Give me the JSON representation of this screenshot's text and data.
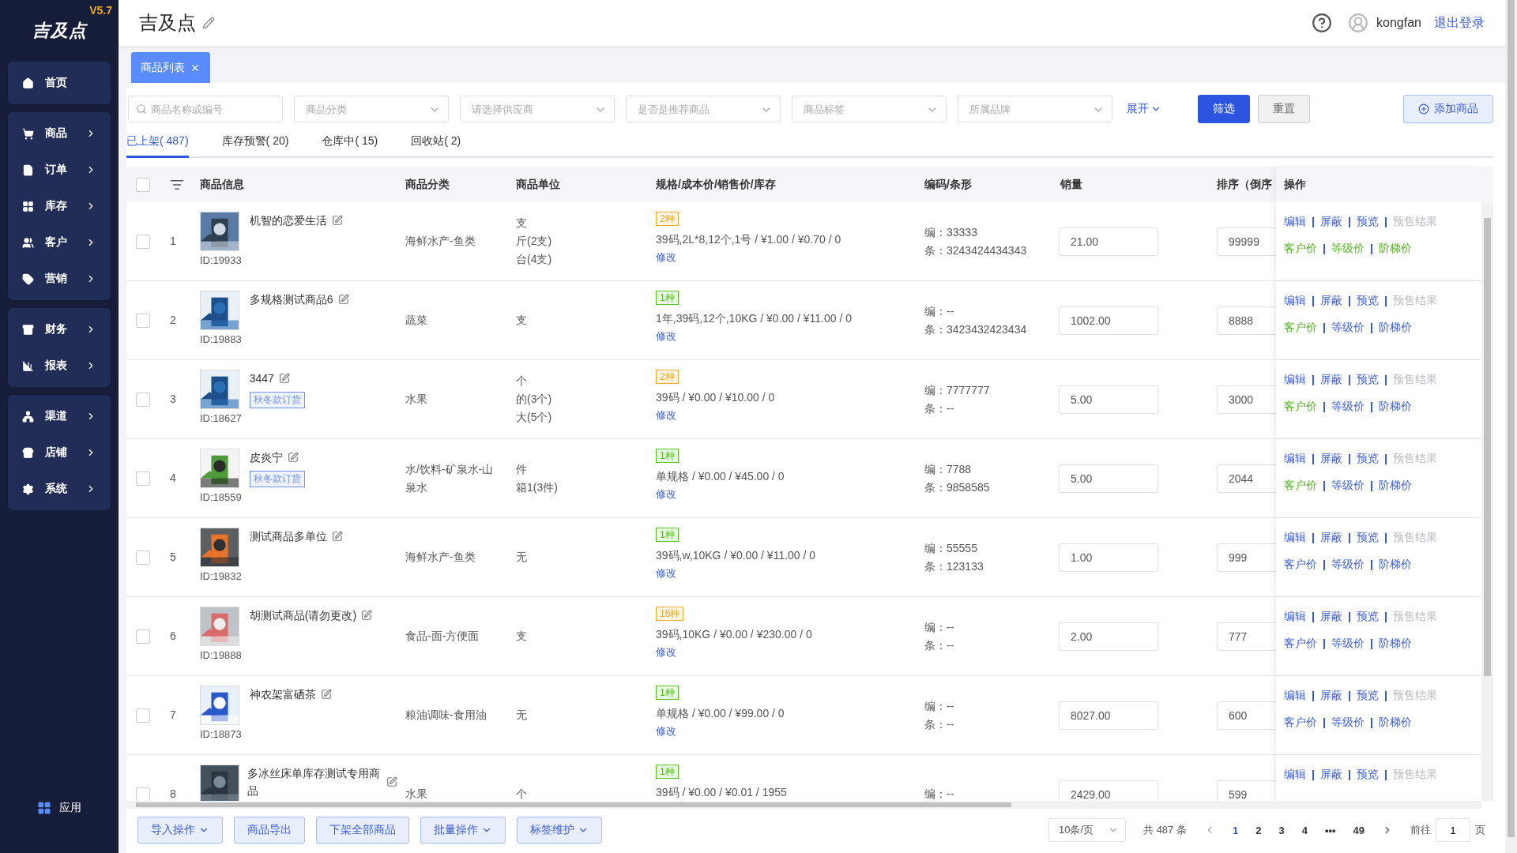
{
  "sidebar": {
    "logo": "吉及点",
    "version": "V5.7",
    "groups": [
      {
        "items": [
          {
            "label": "首页",
            "has_arrow": false
          }
        ]
      },
      {
        "items": [
          {
            "label": "商品",
            "has_arrow": true
          },
          {
            "label": "订单",
            "has_arrow": true
          },
          {
            "label": "库存",
            "has_arrow": true
          },
          {
            "label": "客户",
            "has_arrow": true
          },
          {
            "label": "营销",
            "has_arrow": true
          }
        ]
      },
      {
        "items": [
          {
            "label": "财务",
            "has_arrow": true
          },
          {
            "label": "报表",
            "has_arrow": true
          }
        ]
      },
      {
        "items": [
          {
            "label": "渠道",
            "has_arrow": true
          },
          {
            "label": "店铺",
            "has_arrow": true
          },
          {
            "label": "系统",
            "has_arrow": true
          }
        ]
      }
    ],
    "apps": "应用"
  },
  "header": {
    "title": "吉及点",
    "user": "kongfan",
    "logout": "退出登录"
  },
  "page_tabs": [
    {
      "label": "商品列表",
      "selected": true
    }
  ],
  "filters": {
    "search": {
      "placeholder": "商品名称或编号"
    },
    "selects": [
      {
        "placeholder": "商品分类"
      },
      {
        "placeholder": "请选择供应商"
      },
      {
        "placeholder": "是否是推荐商品"
      },
      {
        "placeholder": "商品标签"
      },
      {
        "placeholder": "所属品牌"
      }
    ],
    "expand": "展开",
    "filter_button": "筛选",
    "reset_button": "重置",
    "add_button": "添加商品"
  },
  "status_tabs": [
    {
      "label": "已上架( 487)",
      "selected": true
    },
    {
      "label": "库存预警( 20)",
      "selected": false
    },
    {
      "label": "仓库中( 15)",
      "selected": false
    },
    {
      "label": "回收站( 2)",
      "selected": false
    }
  ],
  "table": {
    "select_all_checked": false,
    "columns": [
      "商品信息",
      "商品分类",
      "商品单位",
      "规格/成本价/销售价/库存",
      "编码/条形",
      "销量",
      "排序（倒序",
      "操作"
    ],
    "rows": [
      {
        "index": "1",
        "checked": false,
        "name": "机智的恋爱生活",
        "id": "ID:19933",
        "category": "海鲜水产-鱼类",
        "units": [
          "支",
          "斤(2支)",
          "台(4支)"
        ],
        "spec": {
          "badge": "2种",
          "color": "#f5a623",
          "text": "39码,2L*8,12个,1号 / ¥1.00 / ¥0.70 / 0",
          "edit": "修改"
        },
        "code": "编：33333",
        "barcode": "条：3243424434343",
        "sales": "21.00",
        "sort": "99999",
        "actions": [
          {
            "label": "编辑",
            "disabled": false
          },
          {
            "label": "屏蔽",
            "disabled": false
          },
          {
            "label": "预览",
            "disabled": false
          },
          {
            "label": "预售结果",
            "disabled": true
          }
        ],
        "prices": [
          {
            "label": "客户价",
            "highlighted": true
          },
          {
            "label": "等级价",
            "highlighted": true
          },
          {
            "label": "阶梯价",
            "highlighted": true
          }
        ]
      },
      {
        "index": "2",
        "checked": false,
        "name": "多规格测试商品6",
        "id": "ID:19883",
        "category": "蔬菜",
        "units": [
          "支"
        ],
        "spec": {
          "badge": "1种",
          "color": "#52c41a",
          "text": "1年,39码,12个,10KG / ¥0.00 / ¥11.00 / 0",
          "edit": "修改"
        },
        "code": "编：--",
        "barcode": "条：3423432423434",
        "sales": "1002.00",
        "sort": "8888",
        "actions": [
          {
            "label": "编辑",
            "disabled": false
          },
          {
            "label": "屏蔽",
            "disabled": false
          },
          {
            "label": "预览",
            "disabled": false
          },
          {
            "label": "预售结果",
            "disabled": true
          }
        ],
        "prices": [
          {
            "label": "客户价",
            "highlighted": true
          },
          {
            "label": "等级价",
            "highlighted": false
          },
          {
            "label": "阶梯价",
            "highlighted": false
          }
        ]
      },
      {
        "index": "3",
        "checked": false,
        "name": "3447",
        "tag": "秋冬款订货",
        "id": "ID:18627",
        "category": "水果",
        "units": [
          "个",
          "的(3个)",
          "大(5个)"
        ],
        "spec": {
          "badge": "2种",
          "color": "#f5a623",
          "text": "39码 / ¥0.00 / ¥10.00 / 0",
          "edit": "修改"
        },
        "code": "编：7777777",
        "barcode": "条：--",
        "sales": "5.00",
        "sort": "3000",
        "actions": [
          {
            "label": "编辑",
            "disabled": false
          },
          {
            "label": "屏蔽",
            "disabled": false
          },
          {
            "label": "预览",
            "disabled": false
          },
          {
            "label": "预售结果",
            "disabled": true
          }
        ],
        "prices": [
          {
            "label": "客户价",
            "highlighted": true
          },
          {
            "label": "等级价",
            "highlighted": false
          },
          {
            "label": "阶梯价",
            "highlighted": false
          }
        ]
      },
      {
        "index": "4",
        "checked": false,
        "name": "皮炎宁",
        "tag": "秋冬款订货",
        "id": "ID:18559",
        "category": "水/饮料-矿泉水-山泉水",
        "units": [
          "件",
          "箱1(3件)"
        ],
        "spec": {
          "badge": "1种",
          "color": "#52c41a",
          "text": "单规格 / ¥0.00 / ¥45.00 / 0",
          "edit": "修改"
        },
        "code": "编：7788",
        "barcode": "条：9858585",
        "sales": "5.00",
        "sort": "2044",
        "actions": [
          {
            "label": "编辑",
            "disabled": false
          },
          {
            "label": "屏蔽",
            "disabled": false
          },
          {
            "label": "预览",
            "disabled": false
          },
          {
            "label": "预售结果",
            "disabled": true
          }
        ],
        "prices": [
          {
            "label": "客户价",
            "highlighted": true
          },
          {
            "label": "等级价",
            "highlighted": false
          },
          {
            "label": "阶梯价",
            "highlighted": false
          }
        ]
      },
      {
        "index": "5",
        "checked": false,
        "name": "测试商品多单位",
        "id": "ID:19832",
        "category": "海鲜水产-鱼类",
        "units": [
          "无"
        ],
        "spec": {
          "badge": "1种",
          "color": "#52c41a",
          "text": "39码,w,10KG / ¥0.00 / ¥11.00 / 0",
          "edit": "修改"
        },
        "code": "编：55555",
        "barcode": "条：123133",
        "sales": "1.00",
        "sort": "999",
        "actions": [
          {
            "label": "编辑",
            "disabled": false
          },
          {
            "label": "屏蔽",
            "disabled": false
          },
          {
            "label": "预览",
            "disabled": false
          },
          {
            "label": "预售结果",
            "disabled": true
          }
        ],
        "prices": [
          {
            "label": "客户价",
            "highlighted": false
          },
          {
            "label": "等级价",
            "highlighted": false
          },
          {
            "label": "阶梯价",
            "highlighted": false
          }
        ]
      },
      {
        "index": "6",
        "checked": false,
        "name": "胡测试商品(请勿更改)",
        "id": "ID:19888",
        "category": "食品-面-方便面",
        "units": [
          "支"
        ],
        "spec": {
          "badge": "16种",
          "color": "#f5a623",
          "text": "39码,10KG / ¥0.00 / ¥230.00 / 0",
          "edit": "修改"
        },
        "code": "编：--",
        "barcode": "条：--",
        "sales": "2.00",
        "sort": "777",
        "actions": [
          {
            "label": "编辑",
            "disabled": false
          },
          {
            "label": "屏蔽",
            "disabled": false
          },
          {
            "label": "预览",
            "disabled": false
          },
          {
            "label": "预售结果",
            "disabled": true
          }
        ],
        "prices": [
          {
            "label": "客户价",
            "highlighted": false
          },
          {
            "label": "等级价",
            "highlighted": false
          },
          {
            "label": "阶梯价",
            "highlighted": false
          }
        ]
      },
      {
        "index": "7",
        "checked": false,
        "name": "神农架富硒茶",
        "id": "ID:18873",
        "category": "粮油调味-食用油",
        "units": [
          "无"
        ],
        "spec": {
          "badge": "1种",
          "color": "#52c41a",
          "text": "单规格 / ¥0.00 / ¥99.00 / 0",
          "edit": "修改"
        },
        "code": "编：--",
        "barcode": "条：--",
        "sales": "8027.00",
        "sort": "600",
        "actions": [
          {
            "label": "编辑",
            "disabled": false
          },
          {
            "label": "屏蔽",
            "disabled": false
          },
          {
            "label": "预览",
            "disabled": false
          },
          {
            "label": "预售结果",
            "disabled": true
          }
        ],
        "prices": [
          {
            "label": "客户价",
            "highlighted": false
          },
          {
            "label": "等级价",
            "highlighted": false
          },
          {
            "label": "阶梯价",
            "highlighted": false
          }
        ]
      },
      {
        "index": "8",
        "checked": false,
        "name": "多冰丝床单库存测试专用商品",
        "category": "水果",
        "units": [
          "个"
        ],
        "spec": {
          "badge": "1种",
          "color": "#52c41a",
          "text": "39码 / ¥0.00 / ¥0.01 / 1955"
        },
        "code": "编：--",
        "sales": "2429.00",
        "sort": "599",
        "actions": [
          {
            "label": "编辑",
            "disabled": false
          },
          {
            "label": "屏蔽",
            "disabled": false
          },
          {
            "label": "预览",
            "disabled": false
          },
          {
            "label": "预售结果",
            "disabled": true
          }
        ]
      }
    ]
  },
  "bottom_actions": [
    {
      "label": "导入操作",
      "has_menu": true
    },
    {
      "label": "商品导出",
      "has_menu": false
    },
    {
      "label": "下架全部商品",
      "has_menu": false
    },
    {
      "label": "批量操作",
      "has_menu": true
    },
    {
      "label": "标签维护",
      "has_menu": true
    }
  ],
  "pagination": {
    "page_size": "10条/页",
    "total": "共 487 条",
    "pages": [
      {
        "label": "1",
        "selected": true
      },
      {
        "label": "2",
        "selected": false
      },
      {
        "label": "3",
        "selected": false
      },
      {
        "label": "4",
        "selected": false
      },
      {
        "label": "•••",
        "selected": false
      },
      {
        "label": "49",
        "selected": false
      }
    ],
    "goto_label": "前往",
    "goto_value": "1",
    "goto_suffix": "页"
  }
}
